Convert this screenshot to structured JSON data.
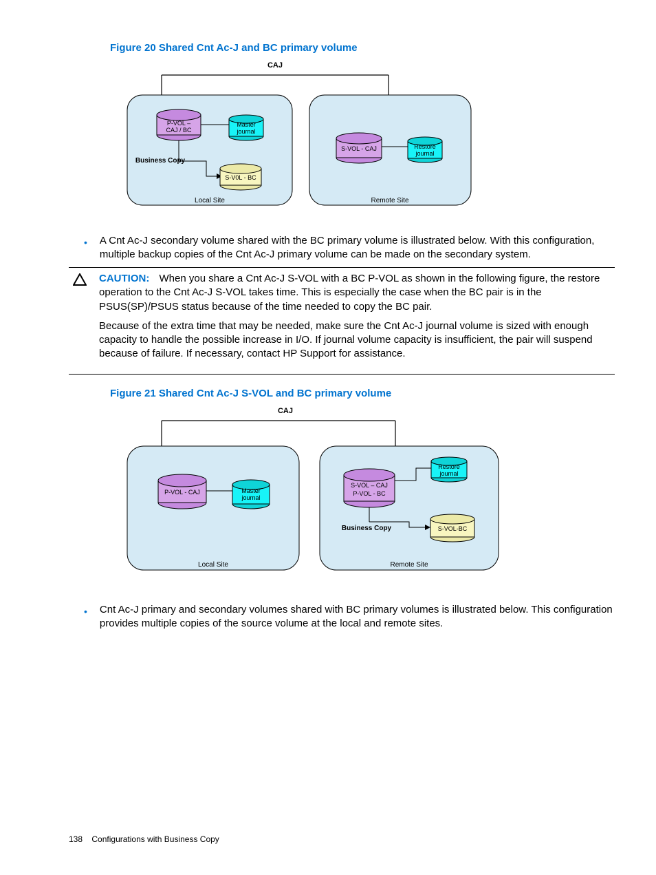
{
  "fig1": {
    "title": "Figure 20 Shared Cnt Ac-J and BC primary volume",
    "top_label": "CAJ",
    "local": {
      "site_label": "Local Site",
      "pvol": "P-VOL –\nCAJ / BC",
      "master": "Master\njournal",
      "bc_label": "Business Copy",
      "svol": "S-V0L - BC"
    },
    "remote": {
      "site_label": "Remote Site",
      "svol": "S-VOL - CAJ",
      "restore": "Restore\njournal"
    }
  },
  "bullet1": "A Cnt Ac-J secondary volume shared with the BC primary volume is illustrated below. With this configuration, multiple backup copies of the Cnt Ac-J primary volume can be made on the secondary system.",
  "caution": {
    "label": "CAUTION:",
    "p1": "When you share a Cnt Ac-J S-VOL with a BC P-VOL as shown in the following figure, the restore operation to the Cnt Ac-J S-VOL takes time. This is especially the case when the BC pair is in the PSUS(SP)/PSUS status because of the time needed to copy the BC pair.",
    "p2": "Because of the extra time that may be needed, make sure the Cnt Ac-J journal volume is sized with enough capacity to handle the possible increase in I/O. If journal volume capacity is insufficient, the pair will suspend because of failure. If necessary, contact HP Support for assistance."
  },
  "fig2": {
    "title": "Figure 21 Shared Cnt Ac-J S-VOL and BC primary volume",
    "top_label": "CAJ",
    "local": {
      "site_label": "Local Site",
      "pvol": "P-VOL - CAJ",
      "master": "Master\njournal"
    },
    "remote": {
      "site_label": "Remote Site",
      "svol": "S-VOL – CAJ\nP-VOL - BC",
      "restore": "Restore\njournal",
      "bc_label": "Business Copy",
      "svol_bc": "S-VOL-BC"
    }
  },
  "bullet2": "Cnt Ac-J primary and secondary volumes shared with BC primary volumes is illustrated below. This configuration provides multiple copies of the source volume at the local and remote sites.",
  "footer": {
    "page": "138",
    "section": "Configurations with Business Copy"
  },
  "colors": {
    "accent": "#0073cf",
    "site_bg": "#d5eaf5",
    "vol_purple": "#d6a4e8",
    "vol_purple_top": "#c58adf",
    "vol_cyan": "#18f4f8",
    "vol_cyan_top": "#0fd4d8",
    "vol_yellow": "#f8f6c0",
    "vol_yellow_top": "#eceaa8"
  }
}
